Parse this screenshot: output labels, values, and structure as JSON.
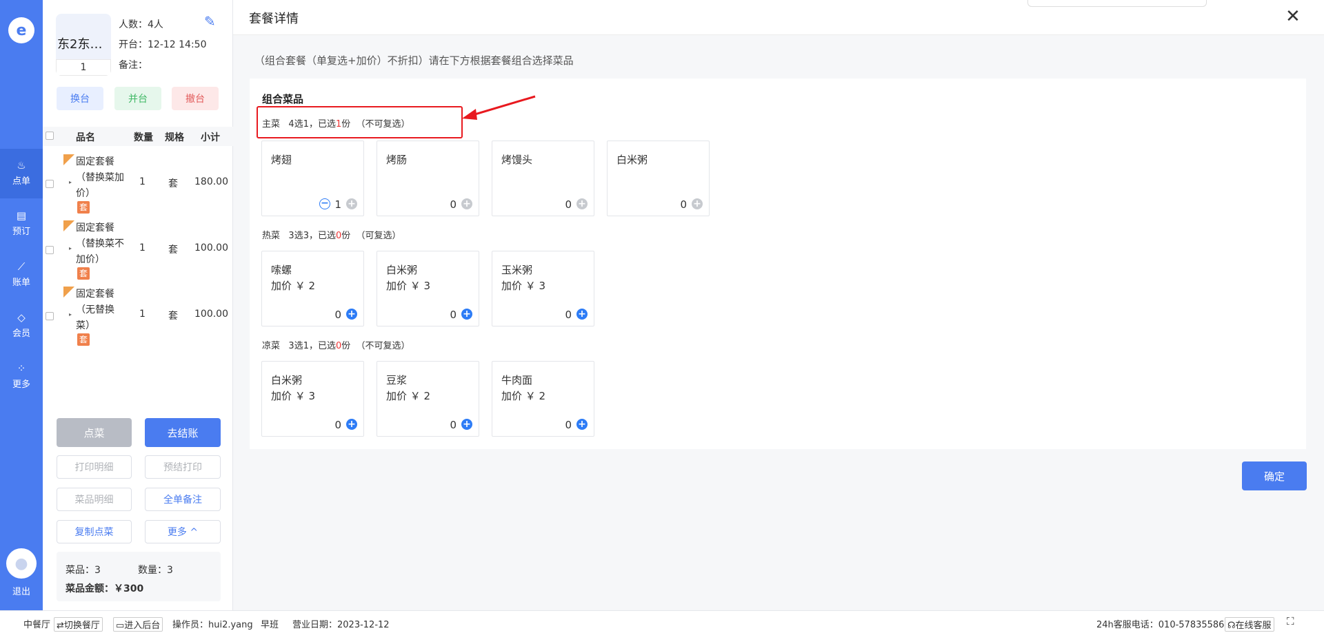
{
  "nav": {
    "items": [
      {
        "label": "点单",
        "icon": "chef-hat-icon",
        "active": true
      },
      {
        "label": "预订",
        "icon": "book-icon",
        "active": false
      },
      {
        "label": "账单",
        "icon": "chart-icon",
        "active": false
      },
      {
        "label": "会员",
        "icon": "diamond-icon",
        "active": false
      },
      {
        "label": "更多",
        "icon": "grid-icon",
        "active": false
      }
    ],
    "logout": "退出"
  },
  "order": {
    "table_name": "东2东…",
    "seat": "1",
    "guests": "人数：4人",
    "open_time": "开台：12-12 14:50",
    "remark": "备注：",
    "actions": {
      "change": "换台",
      "merge": "并台",
      "cancel": "撤台"
    },
    "columns": {
      "name": "品名",
      "qty": "数量",
      "spec": "规格",
      "subtotal": "小计"
    },
    "rows": [
      {
        "name": "固定套餐（替换菜加价）",
        "qty": "1",
        "unit": "套",
        "subtotal": "180.00",
        "tag": "套"
      },
      {
        "name": "固定套餐（替换菜不加价）",
        "qty": "1",
        "unit": "套",
        "subtotal": "100.00",
        "tag": "套"
      },
      {
        "name": "固定套餐（无替换菜）",
        "qty": "1",
        "unit": "套",
        "subtotal": "100.00",
        "tag": "套"
      }
    ],
    "buttons": {
      "order": "点菜",
      "checkout": "去结账",
      "print_detail": "打印明细",
      "pre_print": "预结打印",
      "dish_detail": "菜品明细",
      "note_all": "全单备注",
      "copy": "复制点菜",
      "more": "更多 ^"
    },
    "summary": {
      "dishes": "菜品：3",
      "count": "数量：3",
      "amount": "菜品金额：￥300"
    }
  },
  "modal": {
    "title": "套餐详情",
    "description": "（组合套餐（单复选+加价）不折扣）请在下方根据套餐组合选择菜品",
    "section_title": "组合菜品",
    "groups": [
      {
        "name": "主菜",
        "rule_prefix": "4选1，已选",
        "selected": "1",
        "rule_suffix": "份",
        "mode": "（不可复选）",
        "items": [
          {
            "name": "烤翅",
            "price": "",
            "count": "1"
          },
          {
            "name": "烤肠",
            "price": "",
            "count": "0"
          },
          {
            "name": "烤馒头",
            "price": "",
            "count": "0"
          },
          {
            "name": "白米粥",
            "price": "",
            "count": "0"
          }
        ]
      },
      {
        "name": "热菜",
        "rule_prefix": "3选3，已选",
        "selected": "0",
        "rule_suffix": "份",
        "mode": "（可复选）",
        "items": [
          {
            "name": "嗦螺",
            "price": "加价 ￥ 2",
            "count": "0"
          },
          {
            "name": "白米粥",
            "price": "加价 ￥ 3",
            "count": "0"
          },
          {
            "name": "玉米粥",
            "price": "加价 ￥ 3",
            "count": "0"
          }
        ]
      },
      {
        "name": "凉菜",
        "rule_prefix": "3选1，已选",
        "selected": "0",
        "rule_suffix": "份",
        "mode": "（不可复选）",
        "items": [
          {
            "name": "白米粥",
            "price": "加价 ￥ 3",
            "count": "0"
          },
          {
            "name": "豆浆",
            "price": "加价 ￥ 2",
            "count": "0"
          },
          {
            "name": "牛肉面",
            "price": "加价 ￥ 2",
            "count": "0"
          }
        ]
      }
    ],
    "confirm": "确定"
  },
  "status": {
    "hall": "中餐厅",
    "switch": "切换餐厅",
    "backend": "进入后台",
    "operator": "操作员：hui2.yang",
    "shift": "早班",
    "business_date": "营业日期：2023-12-12",
    "hotline": "24h客服电话：010-57835586",
    "online": "在线客服"
  },
  "colors": {
    "primary": "#4a7cf0",
    "highlight": "#e8191f",
    "tag": "#f0804b"
  }
}
